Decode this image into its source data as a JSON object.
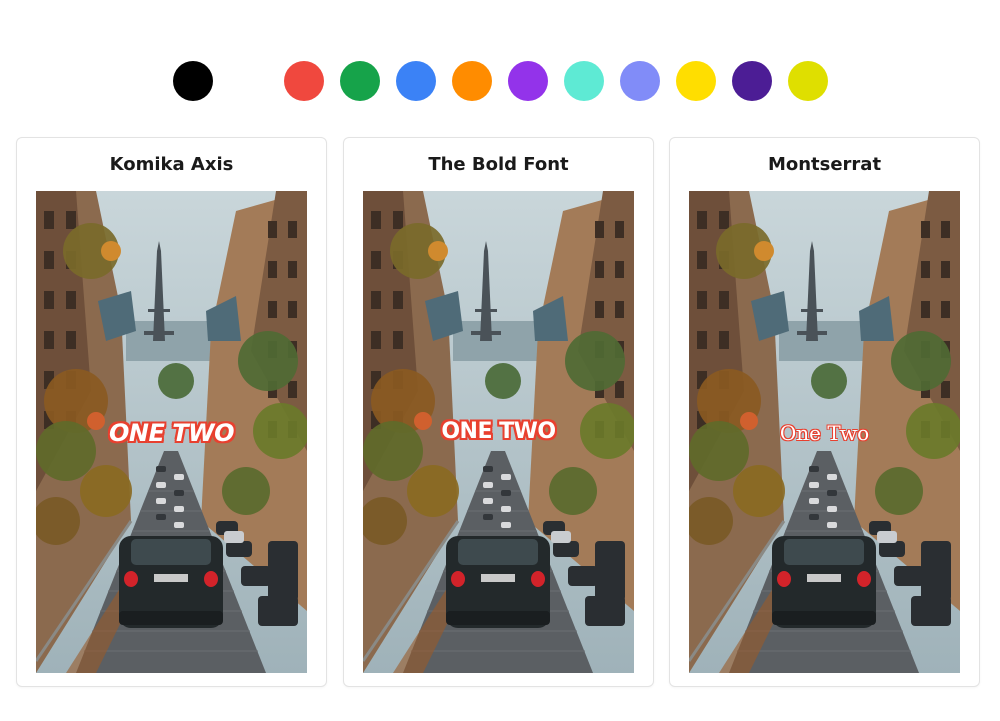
{
  "color_palette": {
    "swatches": [
      {
        "name": "black",
        "color": "#000000"
      },
      {
        "name": "red",
        "color": "#f0483e"
      },
      {
        "name": "green",
        "color": "#16a34a"
      },
      {
        "name": "blue",
        "color": "#3b82f6"
      },
      {
        "name": "orange",
        "color": "#ff8c00"
      },
      {
        "name": "purple",
        "color": "#9333ea"
      },
      {
        "name": "turquoise",
        "color": "#5eead4"
      },
      {
        "name": "periwinkle",
        "color": "#818cf8"
      },
      {
        "name": "yellow",
        "color": "#ffde00"
      },
      {
        "name": "indigo",
        "color": "#4c1d95"
      },
      {
        "name": "lime-yellow",
        "color": "#dfdf00"
      }
    ]
  },
  "font_cards": [
    {
      "title": "Komika Axis",
      "caption": "ONE TWO",
      "caption_fill": "#ffffff",
      "caption_stroke": "#e8402f"
    },
    {
      "title": "The Bold Font",
      "caption": "ONE TWO",
      "caption_fill": "#ffffff",
      "caption_stroke": "#e8402f"
    },
    {
      "title": "Montserrat",
      "caption": "One Two",
      "caption_fill": "#ffffff",
      "caption_stroke": "#e8402f"
    }
  ]
}
